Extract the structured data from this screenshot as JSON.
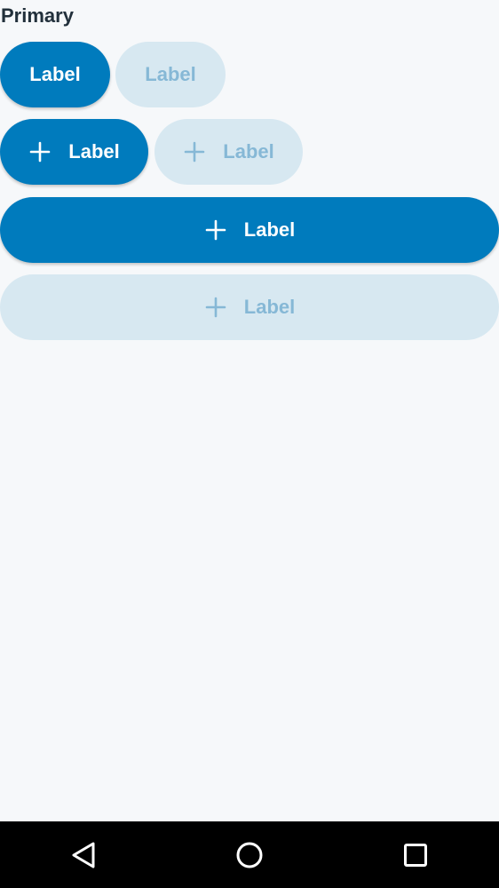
{
  "section": {
    "title": "Primary"
  },
  "buttons": [
    {
      "label": "Label",
      "state": "enabled",
      "icon": ""
    },
    {
      "label": "Label",
      "state": "disabled",
      "icon": ""
    },
    {
      "label": "Label",
      "state": "enabled",
      "icon": "plus-icon"
    },
    {
      "label": "Label",
      "state": "disabled",
      "icon": "plus-icon"
    },
    {
      "label": "Label",
      "state": "enabled",
      "icon": "plus-icon"
    },
    {
      "label": "Label",
      "state": "disabled",
      "icon": "plus-icon"
    }
  ],
  "colors": {
    "background": "#f6f8fa",
    "primary": "#007bbd",
    "primary_text": "#ffffff",
    "disabled_bg": "#d7e8f1",
    "disabled_text": "#86b8d6",
    "title_text": "#22303b",
    "navbar": "#000000"
  },
  "navbar": {
    "items": [
      {
        "icon": "back-icon"
      },
      {
        "icon": "home-icon"
      },
      {
        "icon": "recents-icon"
      }
    ]
  }
}
